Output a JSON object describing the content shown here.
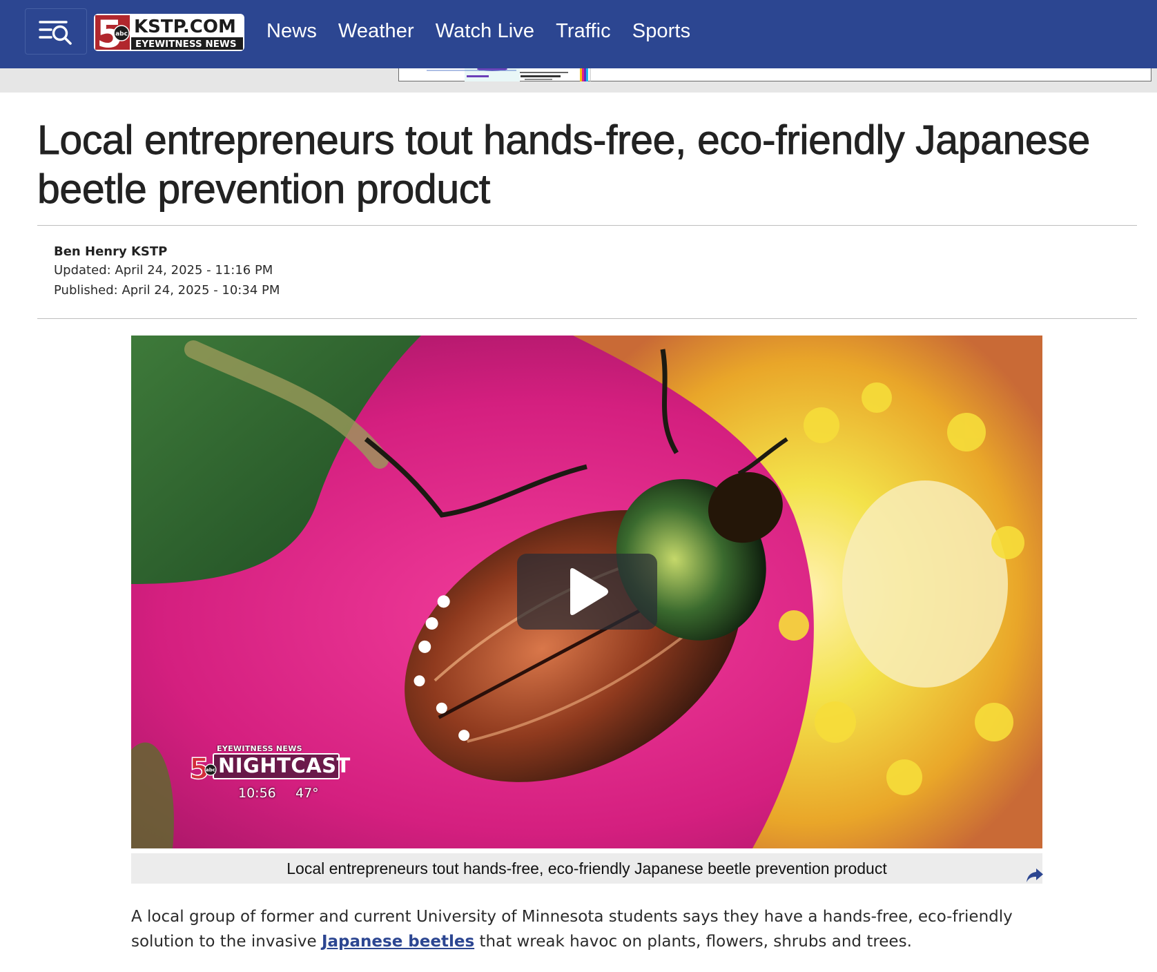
{
  "header": {
    "logo": {
      "number": "5",
      "network": "abc",
      "site": "KSTP.COM",
      "tagline": "EYEWITNESS NEWS"
    },
    "nav": [
      {
        "label": "News"
      },
      {
        "label": "Weather"
      },
      {
        "label": "Watch Live"
      },
      {
        "label": "Traffic"
      },
      {
        "label": "Sports"
      }
    ],
    "icons": {
      "menu": "menu-search-icon"
    },
    "colors": {
      "bar": "#2c4691"
    }
  },
  "article": {
    "title": "Local entrepreneurs tout hands-free, eco-friendly Japanese beetle prevention product",
    "author": "Ben Henry KSTP",
    "updated": "Updated: April 24, 2025 - 11:16 PM",
    "published": "Published: April 24, 2025 - 10:34 PM",
    "video": {
      "caption": "Local entrepreneurs tout hands-free, eco-friendly Japanese beetle prevention product",
      "bug": {
        "number": "5",
        "network": "abc",
        "brand": "EYEWITNESS NEWS",
        "show": "NIGHTCAST",
        "time": "10:56",
        "temperature": "47°"
      },
      "icons": {
        "play": "play-icon",
        "share": "share-icon"
      }
    },
    "body": {
      "lead_before": "A local group of former and current University of Minnesota students says they have a hands-free, eco-friendly solution to the invasive ",
      "link": "Japanese beetles",
      "lead_after": " that wreak havoc on plants, flowers, shrubs and trees."
    },
    "link_color": "#2c4691"
  }
}
